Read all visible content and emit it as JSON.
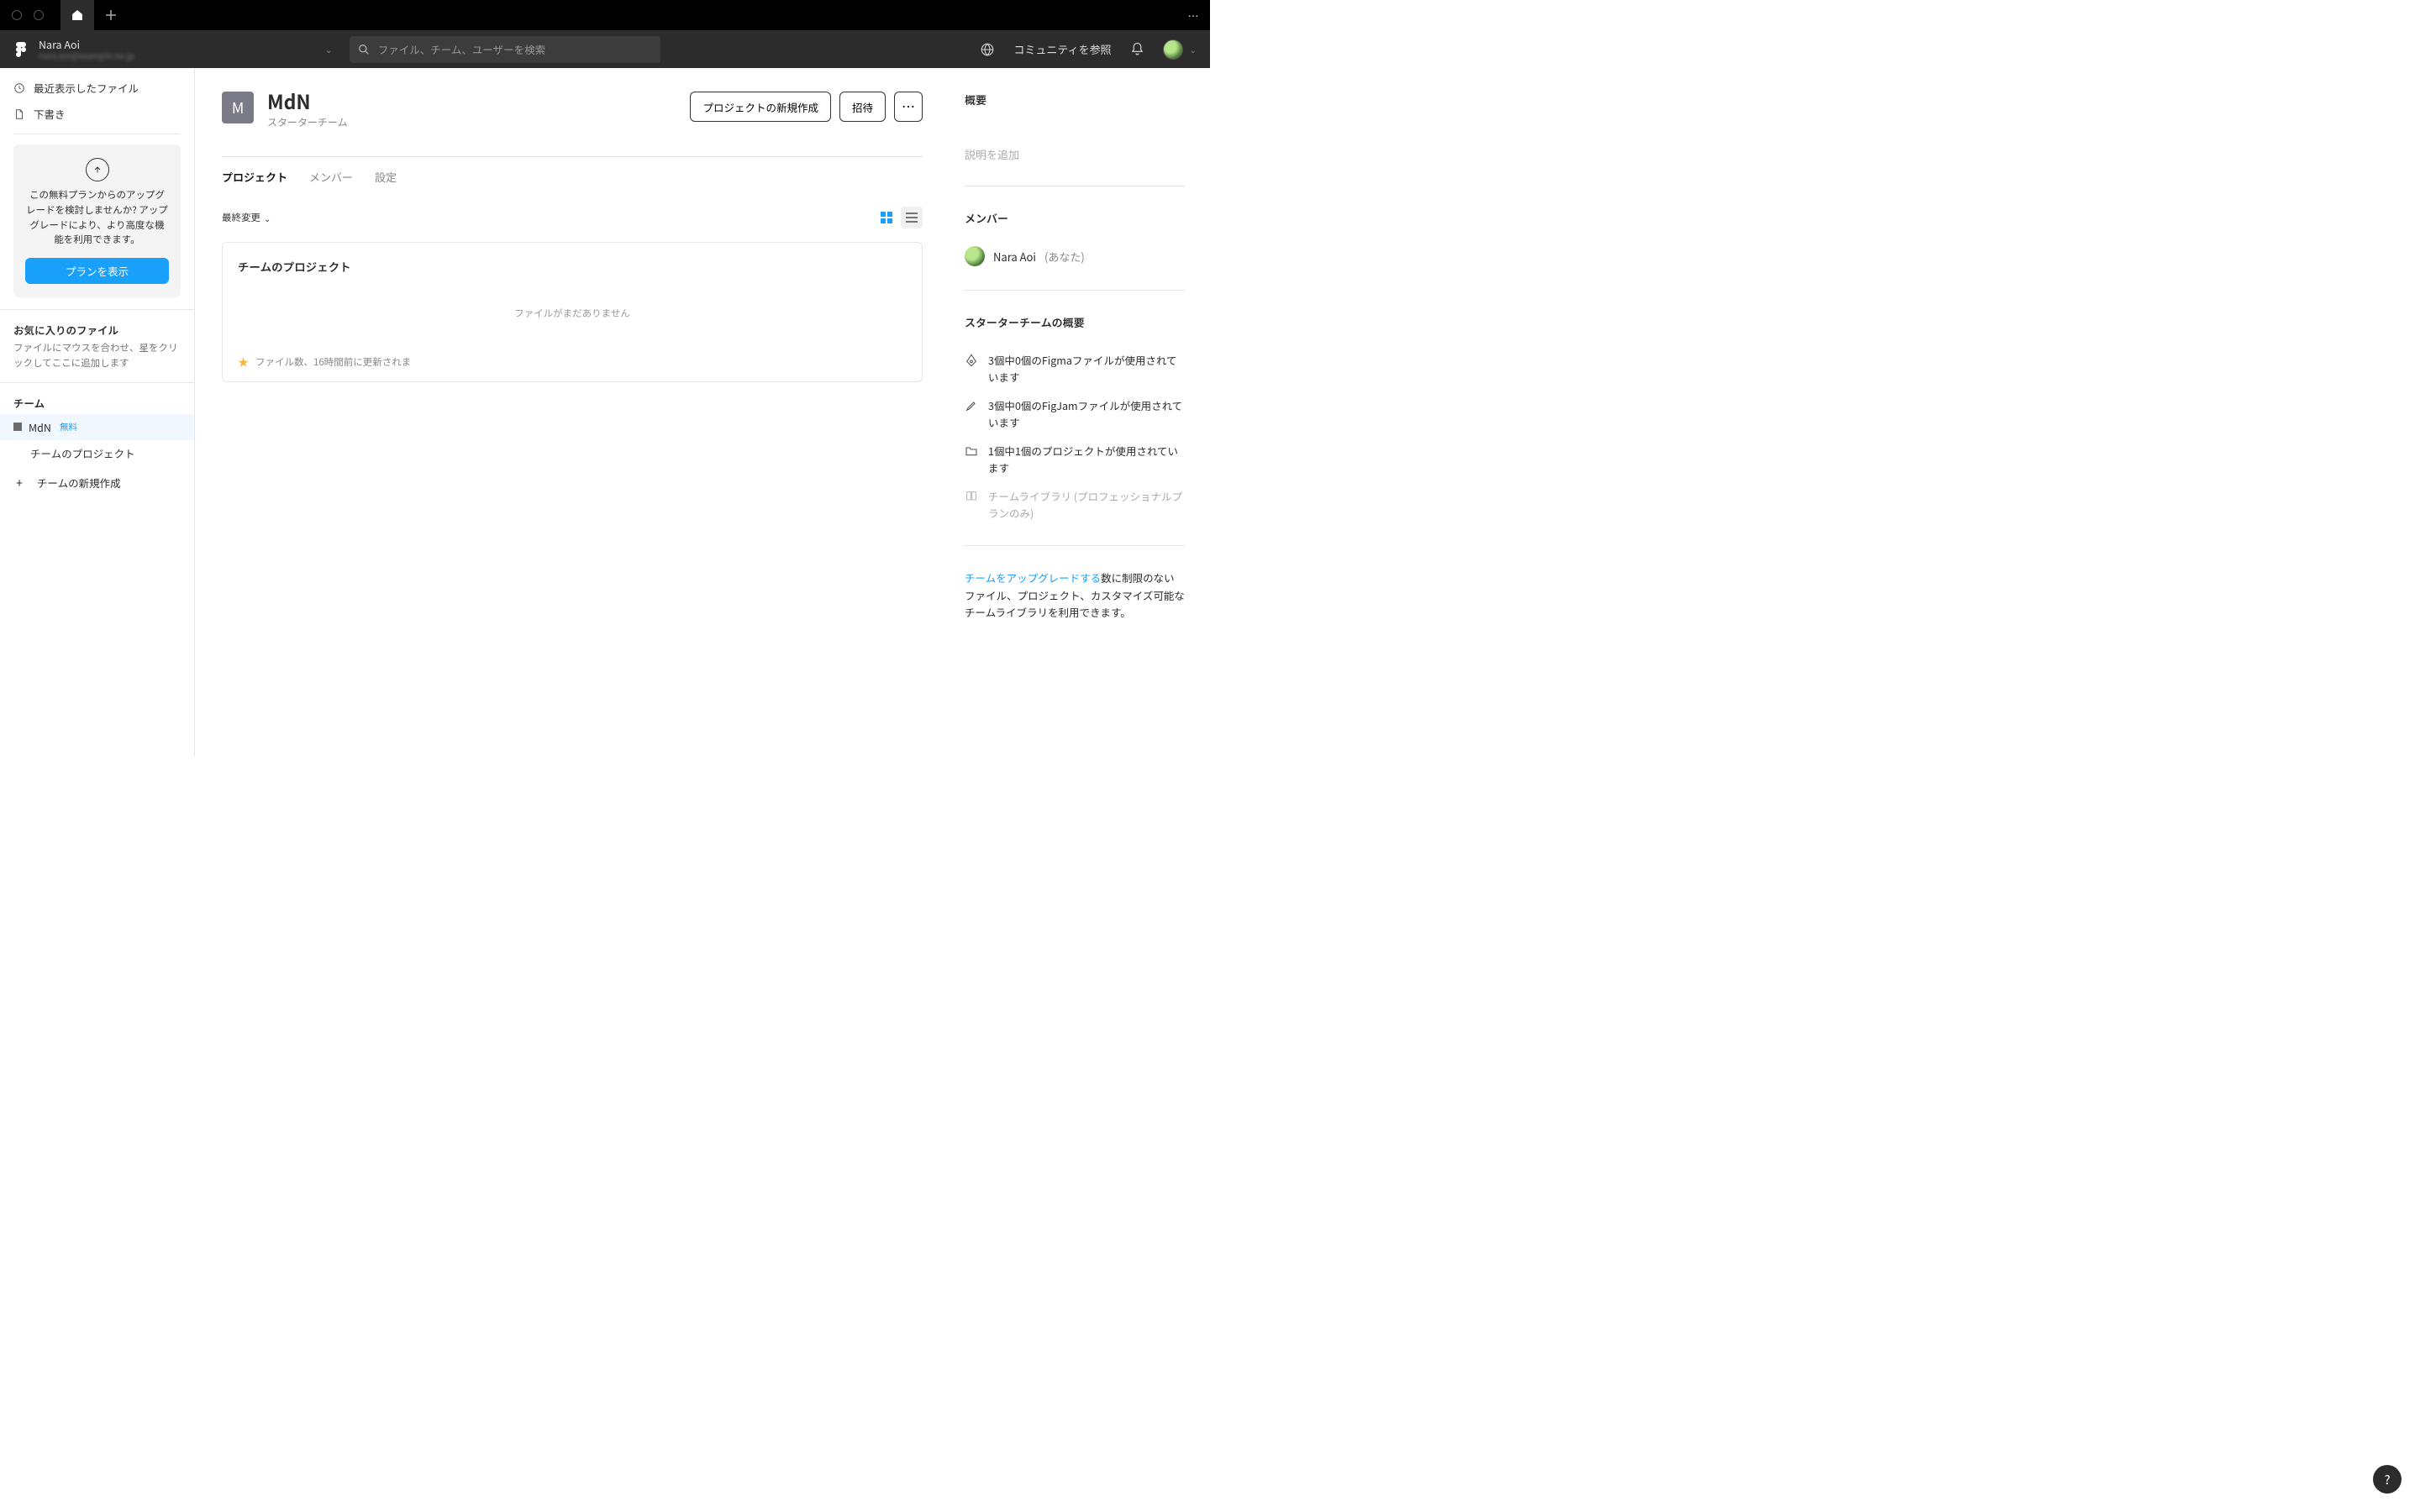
{
  "tabbar": {
    "overflow": "⋯"
  },
  "header": {
    "user_name": "Nara Aoi",
    "user_email": "nara.aoi@example.ne.jp",
    "search_placeholder": "ファイル、チーム、ユーザーを検索",
    "community": "コミュニティを参照"
  },
  "sidebar": {
    "recent": "最近表示したファイル",
    "drafts": "下書き",
    "upgrade": {
      "text": "この無料プランからのアップグレードを検討しませんか? アップグレードにより、より高度な機能を利用できます。",
      "button": "プランを表示"
    },
    "favorites": {
      "head": "お気に入りのファイル",
      "hint": "ファイルにマウスを合わせ、星をクリックしてここに追加します"
    },
    "teams": {
      "head": "チーム",
      "team_name": "MdN",
      "badge": "無料",
      "project": "チームのプロジェクト",
      "new_team": "チームの新規作成"
    }
  },
  "page": {
    "avatar_letter": "M",
    "title": "MdN",
    "subtitle": "スターターチーム",
    "actions": {
      "new_project": "プロジェクトの新規作成",
      "invite": "招待",
      "more": "⋯"
    }
  },
  "tabs": {
    "projects": "プロジェクト",
    "members": "メンバー",
    "settings": "設定"
  },
  "toolbar": {
    "sort": "最終変更"
  },
  "project": {
    "name": "チームのプロジェクト",
    "empty": "ファイルがまだありません",
    "meta": "ファイル数、16時間前に更新されま"
  },
  "right": {
    "overview_head": "概要",
    "desc_placeholder": "説明を追加",
    "members_head": "メンバー",
    "member_name": "Nara Aoi",
    "member_you": "(あなた)",
    "starter_head": "スターターチームの概要",
    "usage": {
      "figma": "3個中0個のFigmaファイルが使用されています",
      "figjam": "3個中0個のFigJamファイルが使用されています",
      "projects": "1個中1個のプロジェクトが使用されています",
      "library": "チームライブラリ (プロフェッショナルプランのみ)"
    },
    "upgrade_link": "チームをアップグレードする",
    "upgrade_rest": "数に制限のないファイル、プロジェクト、カスタマイズ可能なチームライブラリを利用できます。"
  },
  "help": "?"
}
